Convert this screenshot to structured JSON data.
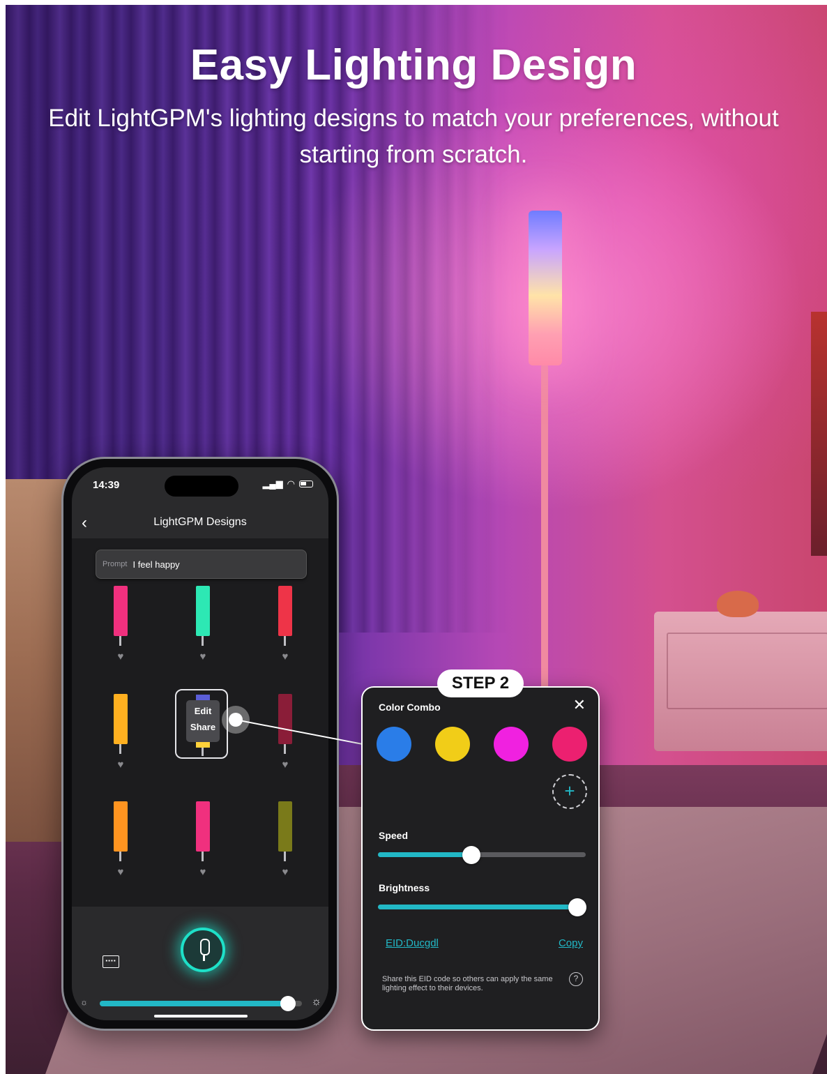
{
  "headline": "Easy Lighting Design",
  "subline": "Edit LightGPM's lighting designs to match your preferences, without starting from scratch.",
  "phone": {
    "status": {
      "time": "14:39"
    },
    "nav": {
      "back_icon": "chevron-left-icon",
      "title": "LightGPM Designs"
    },
    "prompt": {
      "label": "Prompt",
      "value": "I feel happy"
    },
    "designs": [
      {
        "color": "#f0307e"
      },
      {
        "color": "#2de8b4"
      },
      {
        "color": "#ee3448"
      },
      {
        "color": "#ffb020"
      },
      {
        "color": "#d8a020"
      },
      {
        "color": "#8a1d38"
      },
      {
        "color": "#ff9420"
      },
      {
        "color": "#f0307e"
      },
      {
        "color": "#7a7a1a"
      }
    ],
    "edit_menu": {
      "edit": "Edit",
      "share": "Share"
    },
    "bottom": {
      "keyboard_icon": "keyboard-icon",
      "mic_icon": "microphone-icon",
      "brightness_level": 0.93
    }
  },
  "step_badge": "STEP 2",
  "color_combo": {
    "title": "Color Combo",
    "close_icon": "close-icon",
    "colors": [
      "#2a7de8",
      "#f1cd18",
      "#f021e0",
      "#ec2070"
    ],
    "add_icon": "plus-icon",
    "speed": {
      "label": "Speed",
      "value": 0.45
    },
    "brightness": {
      "label": "Brightness",
      "value": 0.96
    },
    "eid": "EID:Ducgdl",
    "copy": "Copy",
    "share_note": "Share this EID code so others can apply the same lighting effect to their devices.",
    "help_icon": "question-icon"
  },
  "colors": {
    "accent": "#22b8c6",
    "mic_glow": "#1ee0c8"
  }
}
